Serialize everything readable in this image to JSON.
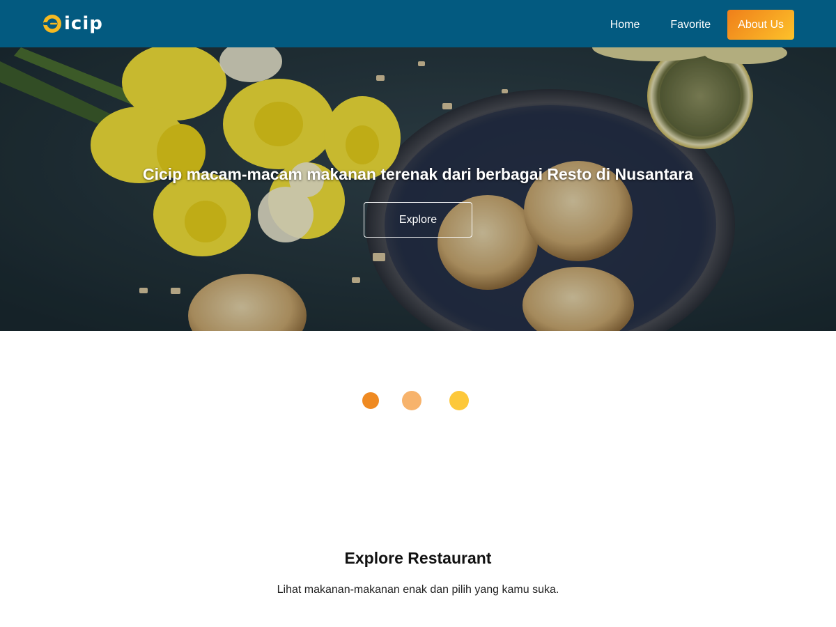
{
  "header": {
    "logo_text": "icip",
    "logo_icon": "plate-fork-icon",
    "nav": [
      {
        "label": "Home",
        "active": false
      },
      {
        "label": "Favorite",
        "active": false
      },
      {
        "label": "About Us",
        "active": true
      }
    ],
    "colors": {
      "background": "#035a80",
      "accent_start": "#ef7f1a",
      "accent_end": "#fdc22a",
      "logo_yellow": "#f5b921"
    }
  },
  "hero": {
    "title": "Cicip macam-macam makanan terenak dari berbagai Resto di Nusantara",
    "button_label": "Explore",
    "background_image": "food-photo-cookies-flowers-lemon"
  },
  "loader": {
    "dot_colors": [
      "#ef8a22",
      "#f7b36c",
      "#fdc83a"
    ]
  },
  "explore": {
    "title": "Explore Restaurant",
    "subtitle": "Lihat makanan-makanan enak dan pilih yang kamu suka."
  }
}
